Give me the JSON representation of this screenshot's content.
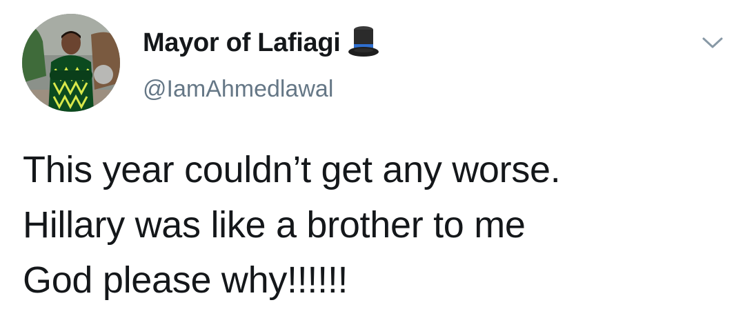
{
  "tweet": {
    "display_name": "Mayor of Lafiagi",
    "name_emoji": "top-hat-icon",
    "handle": "@IamAhmedlawal",
    "lines": [
      "This year couldn’t get any worse.",
      "Hillary was like a brother to me",
      "God please why!!!!!!"
    ]
  },
  "icons": {
    "menu": "chevron-down-icon",
    "avatar": "profile-avatar"
  },
  "colors": {
    "text": "#14171a",
    "secondary": "#657786",
    "background": "#ffffff"
  }
}
